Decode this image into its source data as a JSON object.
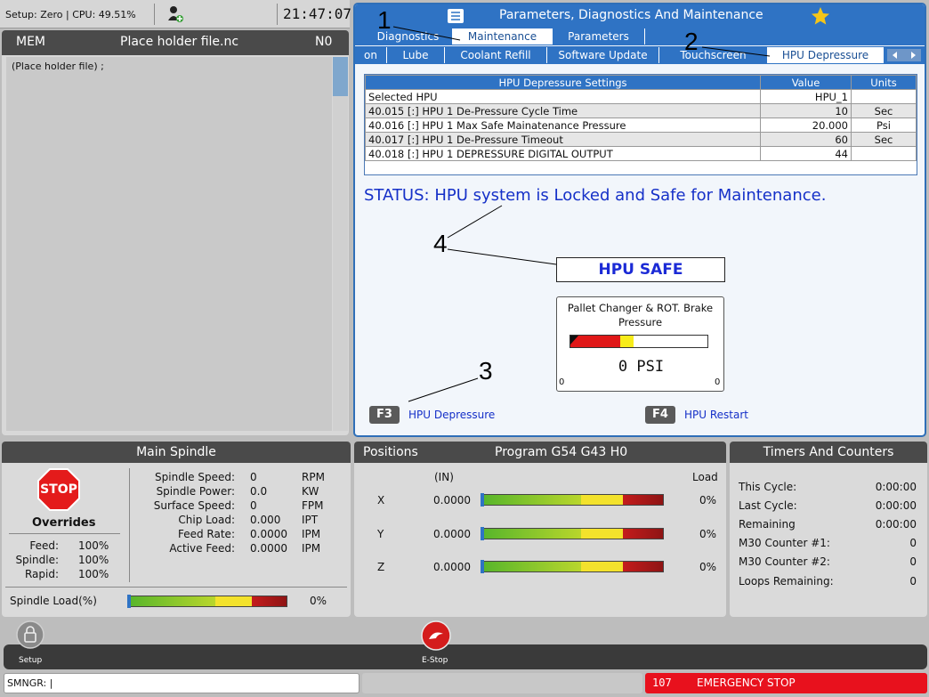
{
  "system": {
    "setup_text": "Setup: Zero | CPU: 49.51%",
    "clock": "21:47:07"
  },
  "program": {
    "mode": "MEM",
    "filename": "Place holder file.nc",
    "line": "N0",
    "code_line": "(Place holder file) ;"
  },
  "params": {
    "title": "Parameters, Diagnostics And Maintenance",
    "tabs_top": [
      "Diagnostics",
      "Maintenance",
      "Parameters"
    ],
    "tabs_sub": [
      "on",
      "Lube",
      "Coolant Refill",
      "Software Update",
      "Touchscreen",
      "HPU Depressure"
    ],
    "table": {
      "title": "HPU Depressure Settings",
      "col_value": "Value",
      "col_units": "Units",
      "rows": [
        {
          "name": "Selected HPU",
          "value": "HPU_1",
          "units": ""
        },
        {
          "name": "40.015 [:] HPU 1 De-Pressure Cycle Time",
          "value": "10",
          "units": "Sec"
        },
        {
          "name": "40.016 [:] HPU 1 Max Safe Mainatenance Pressure",
          "value": "20.000",
          "units": "Psi"
        },
        {
          "name": "40.017 [:] HPU 1 De-Pressure Timeout",
          "value": "60",
          "units": "Sec"
        },
        {
          "name": "40.018 [:] HPU 1 DEPRESSURE DIGITAL OUTPUT",
          "value": "44",
          "units": ""
        }
      ]
    },
    "status": "STATUS:  HPU system is Locked and Safe for Maintenance.",
    "hpu_state": "HPU SAFE",
    "gauge": {
      "label_line1": "Pallet Changer & ROT. Brake",
      "label_line2": "Pressure",
      "reading": "0 PSI",
      "min": "0",
      "max": "0"
    },
    "f3": {
      "key": "F3",
      "label": "HPU Depressure"
    },
    "f4": {
      "key": "F4",
      "label": "HPU Restart"
    },
    "callouts": [
      "1",
      "2",
      "3",
      "4"
    ]
  },
  "spindle": {
    "title": "Main Spindle",
    "stop_label": "STOP",
    "overrides_title": "Overrides",
    "overrides": [
      {
        "label": "Feed:",
        "value": "100%"
      },
      {
        "label": "Spindle:",
        "value": "100%"
      },
      {
        "label": "Rapid:",
        "value": "100%"
      }
    ],
    "stats": [
      {
        "label": "Spindle Speed:",
        "value": "0",
        "unit": "RPM"
      },
      {
        "label": "Spindle Power:",
        "value": "0.0",
        "unit": "KW"
      },
      {
        "label": "Surface Speed:",
        "value": "0",
        "unit": "FPM"
      },
      {
        "label": "Chip Load:",
        "value": "0.000",
        "unit": "IPT"
      },
      {
        "label": "Feed Rate:",
        "value": "0.0000",
        "unit": "IPM"
      },
      {
        "label": "Active Feed:",
        "value": "0.0000",
        "unit": "IPM"
      }
    ],
    "load_label": "Spindle Load(%)",
    "load_value": "0%"
  },
  "positions": {
    "title": "Positions",
    "program": "Program G54 G43 H0",
    "unit": "(IN)",
    "load_header": "Load",
    "axes": [
      {
        "axis": "X",
        "value": "0.0000",
        "load": "0%"
      },
      {
        "axis": "Y",
        "value": "0.0000",
        "load": "0%"
      },
      {
        "axis": "Z",
        "value": "0.0000",
        "load": "0%"
      }
    ]
  },
  "timers": {
    "title": "Timers And Counters",
    "rows": [
      {
        "label": "This Cycle:",
        "value": "0:00:00"
      },
      {
        "label": "Last Cycle:",
        "value": "0:00:00"
      },
      {
        "label": "Remaining",
        "value": "0:00:00"
      },
      {
        "label": "M30 Counter #1:",
        "value": "0"
      },
      {
        "label": "M30 Counter #2:",
        "value": "0"
      },
      {
        "label": "Loops Remaining:",
        "value": "0"
      }
    ]
  },
  "toolbar": {
    "setup_label": "Setup",
    "estop_label": "E-Stop"
  },
  "command": {
    "prompt": "SMNGR: |"
  },
  "alarm": {
    "code": "107",
    "text": "EMERGENCY STOP"
  },
  "colors": {
    "accent": "#2f73c4",
    "alarm": "#e8111d",
    "status_text": "#1530c8"
  }
}
